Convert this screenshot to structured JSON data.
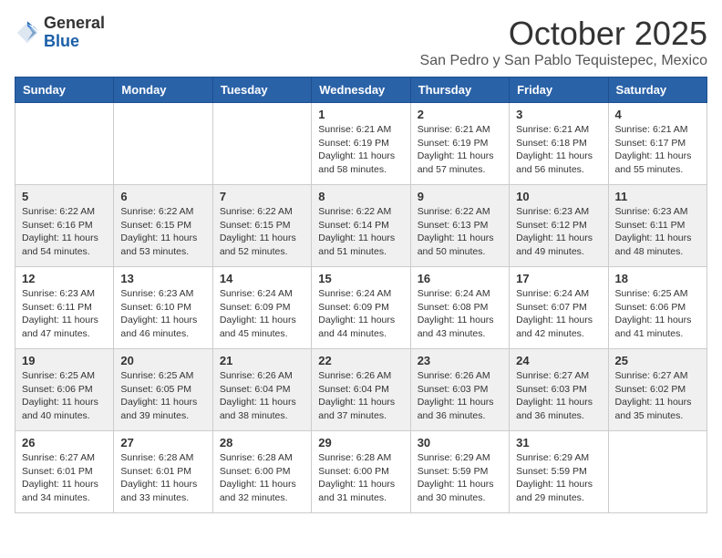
{
  "logo": {
    "general": "General",
    "blue": "Blue"
  },
  "header": {
    "month": "October 2025",
    "location": "San Pedro y San Pablo Tequistepec, Mexico"
  },
  "weekdays": [
    "Sunday",
    "Monday",
    "Tuesday",
    "Wednesday",
    "Thursday",
    "Friday",
    "Saturday"
  ],
  "weeks": [
    [
      {
        "day": "",
        "info": ""
      },
      {
        "day": "",
        "info": ""
      },
      {
        "day": "",
        "info": ""
      },
      {
        "day": "1",
        "info": "Sunrise: 6:21 AM\nSunset: 6:19 PM\nDaylight: 11 hours and 58 minutes."
      },
      {
        "day": "2",
        "info": "Sunrise: 6:21 AM\nSunset: 6:19 PM\nDaylight: 11 hours and 57 minutes."
      },
      {
        "day": "3",
        "info": "Sunrise: 6:21 AM\nSunset: 6:18 PM\nDaylight: 11 hours and 56 minutes."
      },
      {
        "day": "4",
        "info": "Sunrise: 6:21 AM\nSunset: 6:17 PM\nDaylight: 11 hours and 55 minutes."
      }
    ],
    [
      {
        "day": "5",
        "info": "Sunrise: 6:22 AM\nSunset: 6:16 PM\nDaylight: 11 hours and 54 minutes."
      },
      {
        "day": "6",
        "info": "Sunrise: 6:22 AM\nSunset: 6:15 PM\nDaylight: 11 hours and 53 minutes."
      },
      {
        "day": "7",
        "info": "Sunrise: 6:22 AM\nSunset: 6:15 PM\nDaylight: 11 hours and 52 minutes."
      },
      {
        "day": "8",
        "info": "Sunrise: 6:22 AM\nSunset: 6:14 PM\nDaylight: 11 hours and 51 minutes."
      },
      {
        "day": "9",
        "info": "Sunrise: 6:22 AM\nSunset: 6:13 PM\nDaylight: 11 hours and 50 minutes."
      },
      {
        "day": "10",
        "info": "Sunrise: 6:23 AM\nSunset: 6:12 PM\nDaylight: 11 hours and 49 minutes."
      },
      {
        "day": "11",
        "info": "Sunrise: 6:23 AM\nSunset: 6:11 PM\nDaylight: 11 hours and 48 minutes."
      }
    ],
    [
      {
        "day": "12",
        "info": "Sunrise: 6:23 AM\nSunset: 6:11 PM\nDaylight: 11 hours and 47 minutes."
      },
      {
        "day": "13",
        "info": "Sunrise: 6:23 AM\nSunset: 6:10 PM\nDaylight: 11 hours and 46 minutes."
      },
      {
        "day": "14",
        "info": "Sunrise: 6:24 AM\nSunset: 6:09 PM\nDaylight: 11 hours and 45 minutes."
      },
      {
        "day": "15",
        "info": "Sunrise: 6:24 AM\nSunset: 6:09 PM\nDaylight: 11 hours and 44 minutes."
      },
      {
        "day": "16",
        "info": "Sunrise: 6:24 AM\nSunset: 6:08 PM\nDaylight: 11 hours and 43 minutes."
      },
      {
        "day": "17",
        "info": "Sunrise: 6:24 AM\nSunset: 6:07 PM\nDaylight: 11 hours and 42 minutes."
      },
      {
        "day": "18",
        "info": "Sunrise: 6:25 AM\nSunset: 6:06 PM\nDaylight: 11 hours and 41 minutes."
      }
    ],
    [
      {
        "day": "19",
        "info": "Sunrise: 6:25 AM\nSunset: 6:06 PM\nDaylight: 11 hours and 40 minutes."
      },
      {
        "day": "20",
        "info": "Sunrise: 6:25 AM\nSunset: 6:05 PM\nDaylight: 11 hours and 39 minutes."
      },
      {
        "day": "21",
        "info": "Sunrise: 6:26 AM\nSunset: 6:04 PM\nDaylight: 11 hours and 38 minutes."
      },
      {
        "day": "22",
        "info": "Sunrise: 6:26 AM\nSunset: 6:04 PM\nDaylight: 11 hours and 37 minutes."
      },
      {
        "day": "23",
        "info": "Sunrise: 6:26 AM\nSunset: 6:03 PM\nDaylight: 11 hours and 36 minutes."
      },
      {
        "day": "24",
        "info": "Sunrise: 6:27 AM\nSunset: 6:03 PM\nDaylight: 11 hours and 36 minutes."
      },
      {
        "day": "25",
        "info": "Sunrise: 6:27 AM\nSunset: 6:02 PM\nDaylight: 11 hours and 35 minutes."
      }
    ],
    [
      {
        "day": "26",
        "info": "Sunrise: 6:27 AM\nSunset: 6:01 PM\nDaylight: 11 hours and 34 minutes."
      },
      {
        "day": "27",
        "info": "Sunrise: 6:28 AM\nSunset: 6:01 PM\nDaylight: 11 hours and 33 minutes."
      },
      {
        "day": "28",
        "info": "Sunrise: 6:28 AM\nSunset: 6:00 PM\nDaylight: 11 hours and 32 minutes."
      },
      {
        "day": "29",
        "info": "Sunrise: 6:28 AM\nSunset: 6:00 PM\nDaylight: 11 hours and 31 minutes."
      },
      {
        "day": "30",
        "info": "Sunrise: 6:29 AM\nSunset: 5:59 PM\nDaylight: 11 hours and 30 minutes."
      },
      {
        "day": "31",
        "info": "Sunrise: 6:29 AM\nSunset: 5:59 PM\nDaylight: 11 hours and 29 minutes."
      },
      {
        "day": "",
        "info": ""
      }
    ]
  ],
  "row_colors": [
    "white",
    "gray",
    "white",
    "gray",
    "white"
  ]
}
